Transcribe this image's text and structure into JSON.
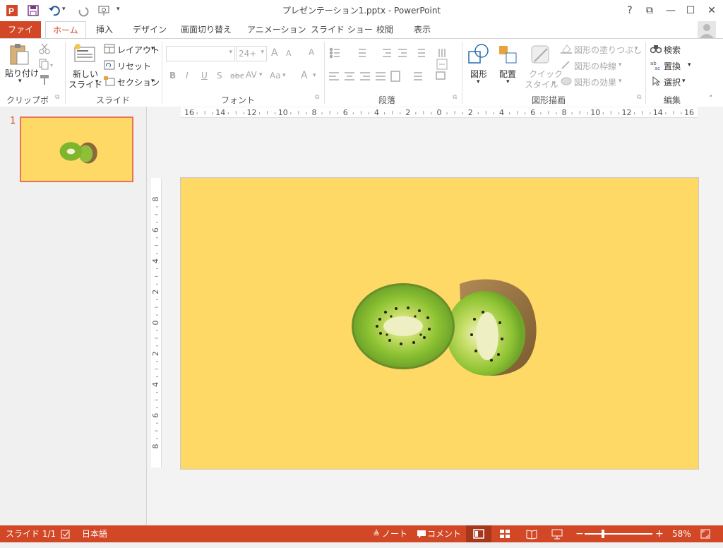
{
  "window": {
    "title": "プレゼンテーション1.pptx - PowerPoint",
    "help": "?",
    "restore_ribbon": "⧉",
    "minimize": "—",
    "maximize": "☐",
    "close": "✕"
  },
  "qat": {
    "app_icon": "powerpoint-icon",
    "save": "save-icon",
    "undo": "undo-icon",
    "redo": "redo-icon",
    "start_from_beginning": "present-icon",
    "customize": "▾"
  },
  "tabs": [
    "ファイル",
    "ホーム",
    "挿入",
    "デザイン",
    "画面切り替え",
    "アニメーション",
    "スライド ショー",
    "校閲",
    "表示"
  ],
  "active_tab": "ホーム",
  "ribbon": {
    "clipboard": {
      "paste": "貼り付け",
      "group": "クリップボード"
    },
    "slides": {
      "new_slide_line1": "新しい",
      "new_slide_line2": "スライド",
      "layout": "レイアウト",
      "reset": "リセット",
      "section": "セクション",
      "group": "スライド"
    },
    "font": {
      "font_name": "",
      "font_size": "24+",
      "grow": "A",
      "shrink": "A",
      "clear": "A",
      "bold": "B",
      "italic": "I",
      "underline": "U",
      "shadow": "S",
      "strike": "abc",
      "spacing": "AV",
      "case": "Aa",
      "color": "A",
      "group": "フォント"
    },
    "paragraph": {
      "group": "段落"
    },
    "drawing": {
      "shapes": "図形",
      "arrange": "配置",
      "quick_line1": "クイック",
      "quick_line2": "スタイル",
      "fill": "図形の塗りつぶし",
      "outline": "図形の枠線",
      "effects": "図形の効果",
      "group": "図形描画"
    },
    "editing": {
      "find": "検索",
      "replace": "置換",
      "select": "選択",
      "group": "編集"
    }
  },
  "slide_panel": {
    "slide_number": "1"
  },
  "rulers": {
    "horizontal": [
      "16",
      "14",
      "12",
      "10",
      "8",
      "6",
      "4",
      "2",
      "0",
      "2",
      "4",
      "6",
      "8",
      "10",
      "12",
      "14",
      "16"
    ],
    "vertical": [
      "8",
      "6",
      "4",
      "2",
      "0",
      "2",
      "4",
      "6",
      "8"
    ]
  },
  "slide": {
    "background_color": "#ffd966",
    "image": "kiwi-halves-image"
  },
  "statusbar": {
    "slide_info": "スライド 1/1",
    "language": "日本語",
    "notes": "ノート",
    "comments": "コメント",
    "zoom": "58%",
    "zoom_level": 0.58
  },
  "colors": {
    "accent": "#d24726",
    "slide_bg": "#ffd966"
  }
}
